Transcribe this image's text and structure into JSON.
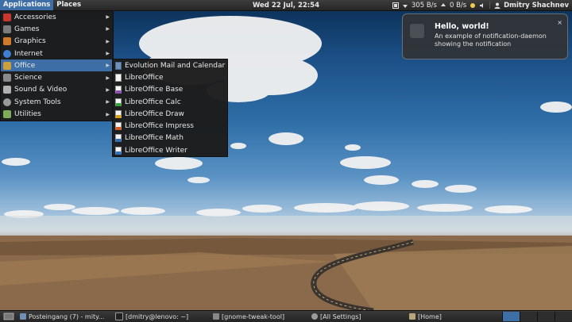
{
  "top_panel": {
    "menus": [
      "Applications",
      "Places"
    ],
    "clock": "Wed 22 Jul, 22:54",
    "net_down": "305 B/s",
    "net_up": "0 B/s",
    "user": "Dmitry Shachnev"
  },
  "applications_menu": {
    "items": [
      {
        "label": "Accessories",
        "icon": "accessories-icon",
        "color": "#c8372d"
      },
      {
        "label": "Games",
        "icon": "games-icon",
        "color": "#7c7c7c"
      },
      {
        "label": "Graphics",
        "icon": "graphics-icon",
        "color": "#d07a2b"
      },
      {
        "label": "Internet",
        "icon": "internet-icon",
        "color": "#3f7fd0"
      },
      {
        "label": "Office",
        "icon": "office-icon",
        "color": "#c9a03c"
      },
      {
        "label": "Science",
        "icon": "science-icon",
        "color": "#8a8a8a"
      },
      {
        "label": "Sound & Video",
        "icon": "sound-video-icon",
        "color": "#b0b0b0"
      },
      {
        "label": "System Tools",
        "icon": "system-tools-icon",
        "color": "#9a9a9a"
      },
      {
        "label": "Utilities",
        "icon": "utilities-icon",
        "color": "#7faa5a"
      }
    ],
    "active": "Office"
  },
  "office_menu": {
    "items": [
      {
        "label": "Evolution Mail and Calendar",
        "icon": "evolution-icon",
        "color": "#6f8fb8"
      },
      {
        "label": "LibreOffice",
        "icon": "libreoffice-icon",
        "color": "#ffffff"
      },
      {
        "label": "LibreOffice Base",
        "icon": "libreoffice-base-icon",
        "color": "#8e4fb0"
      },
      {
        "label": "LibreOffice Calc",
        "icon": "libreoffice-calc-icon",
        "color": "#3aa13a"
      },
      {
        "label": "LibreOffice Draw",
        "icon": "libreoffice-draw-icon",
        "color": "#d7a21a"
      },
      {
        "label": "LibreOffice Impress",
        "icon": "libreoffice-impress-icon",
        "color": "#d45a1f"
      },
      {
        "label": "LibreOffice Math",
        "icon": "libreoffice-math-icon",
        "color": "#2c6fb3"
      },
      {
        "label": "LibreOffice Writer",
        "icon": "libreoffice-writer-icon",
        "color": "#2f73c4"
      }
    ]
  },
  "notification": {
    "title": "Hello, world!",
    "body_line1": "An example of notification-daemon",
    "body_line2": "showing the notification",
    "close": "×"
  },
  "taskbar": {
    "tasks": [
      {
        "label": "Posteingang (7) - mity...",
        "icon": "evolution-icon"
      },
      {
        "label": "[dmitry@lenovo: ~]",
        "icon": "terminal-icon"
      },
      {
        "label": "[gnome-tweak-tool]",
        "icon": "tweak-icon"
      },
      {
        "label": "[All Settings]",
        "icon": "settings-icon"
      },
      {
        "label": "[Home]",
        "icon": "folder-icon"
      }
    ]
  },
  "colors": {
    "accent": "#3e6ea6",
    "panel": "#2b2b2b"
  }
}
